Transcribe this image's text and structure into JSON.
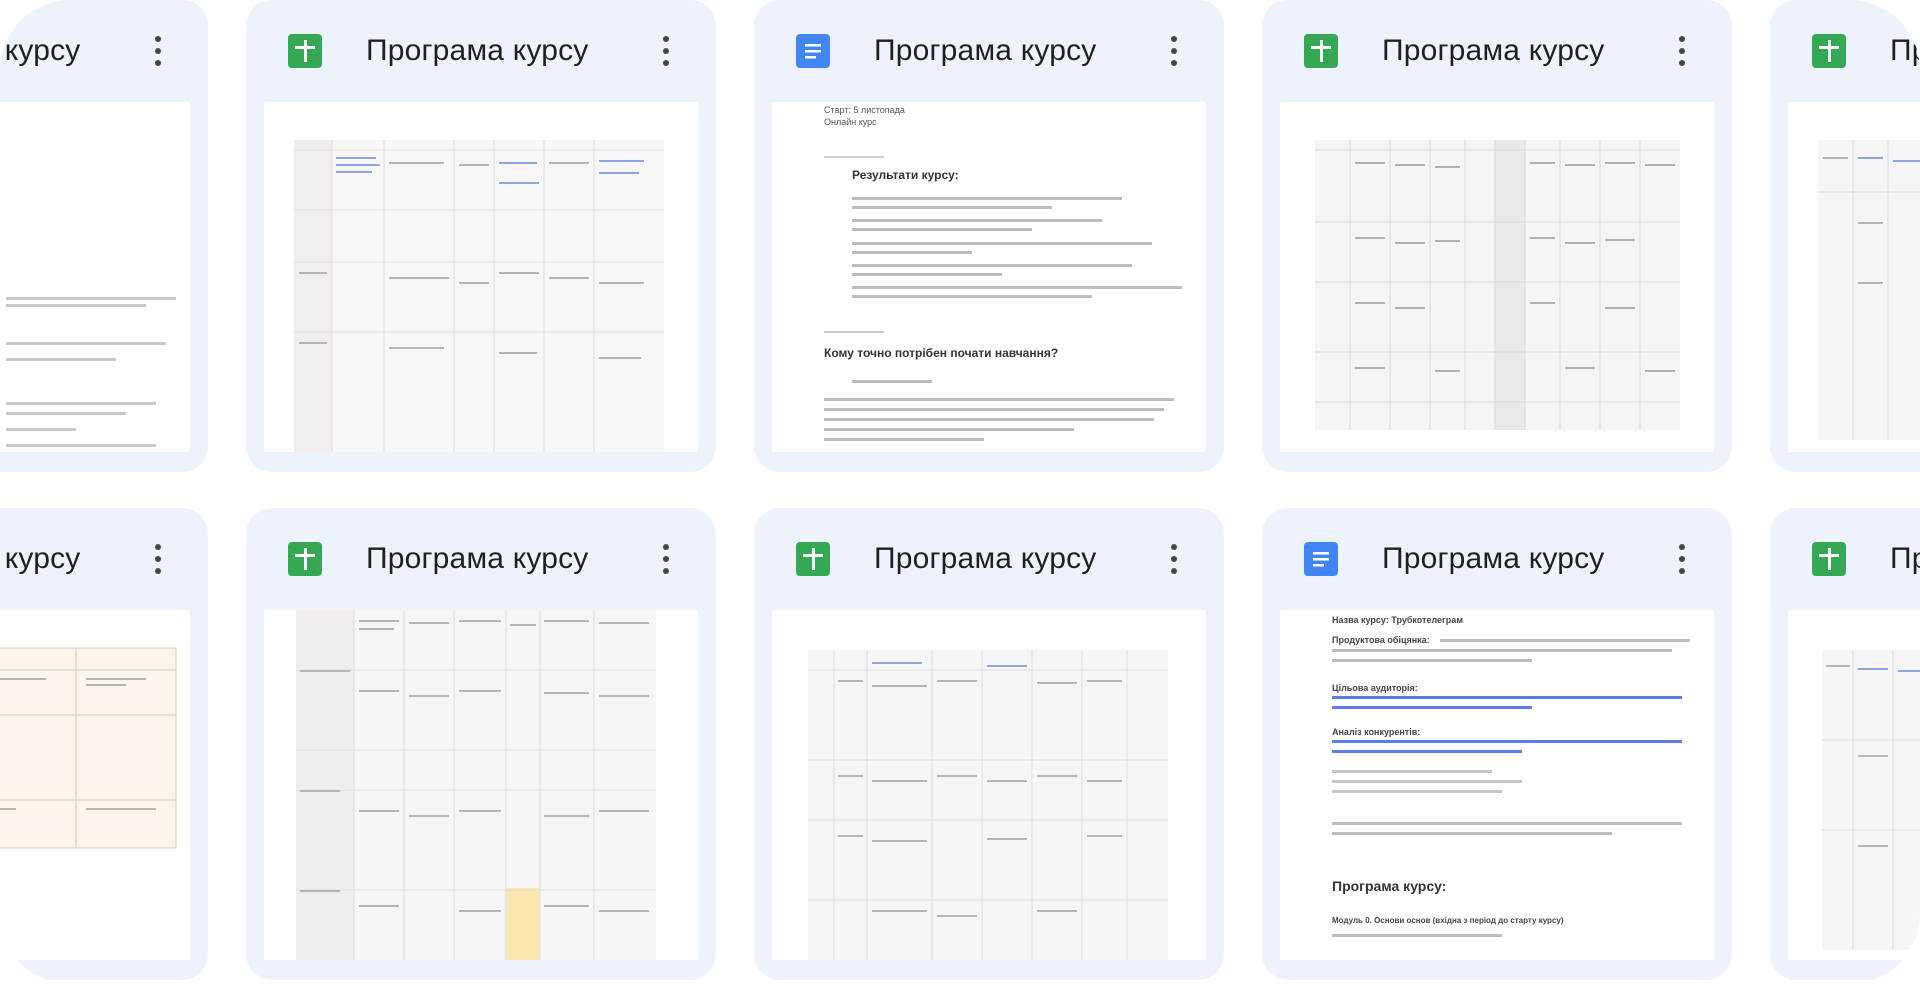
{
  "cards": [
    {
      "id": "r1c0",
      "type": "sheet",
      "title": "Програма курсу"
    },
    {
      "id": "r1c1",
      "type": "sheet",
      "title": "Програма курсу"
    },
    {
      "id": "r1c2",
      "type": "doc",
      "title": "Програма курсу"
    },
    {
      "id": "r1c3",
      "type": "sheet",
      "title": "Програма курсу"
    },
    {
      "id": "r1c4",
      "type": "sheet",
      "title": "Програма курсу"
    },
    {
      "id": "r2c0",
      "type": "doc",
      "title": "Програма курсу"
    },
    {
      "id": "r2c1",
      "type": "sheet",
      "title": "Програма курсу"
    },
    {
      "id": "r2c2",
      "type": "sheet",
      "title": "Програма курсу"
    },
    {
      "id": "r2c3",
      "type": "doc",
      "title": "Програма курсу"
    },
    {
      "id": "r2c4",
      "type": "sheet",
      "title": "Програма курсу"
    }
  ],
  "doc_preview_1": {
    "line1": "Старт: 5 листопада",
    "line2": "Онлайн курс",
    "heading1": "Результати курсу:",
    "heading2": "Кому точно потрібен почати навчання?"
  },
  "doc_preview_2": {
    "line1": "Назва курсу: Трубкотелеграм",
    "label1": "Продуктова обіцянка:",
    "label2": "Цільова аудиторія:",
    "label3": "Аналіз конкурентів:",
    "heading": "Програма курсу:",
    "module": "Модуль 0. Основи основ (вхідна з період до старту курсу)"
  },
  "colors": {
    "sheet_icon": "#34a853",
    "doc_icon": "#4285f4",
    "card_bg": "#eef2fb"
  }
}
